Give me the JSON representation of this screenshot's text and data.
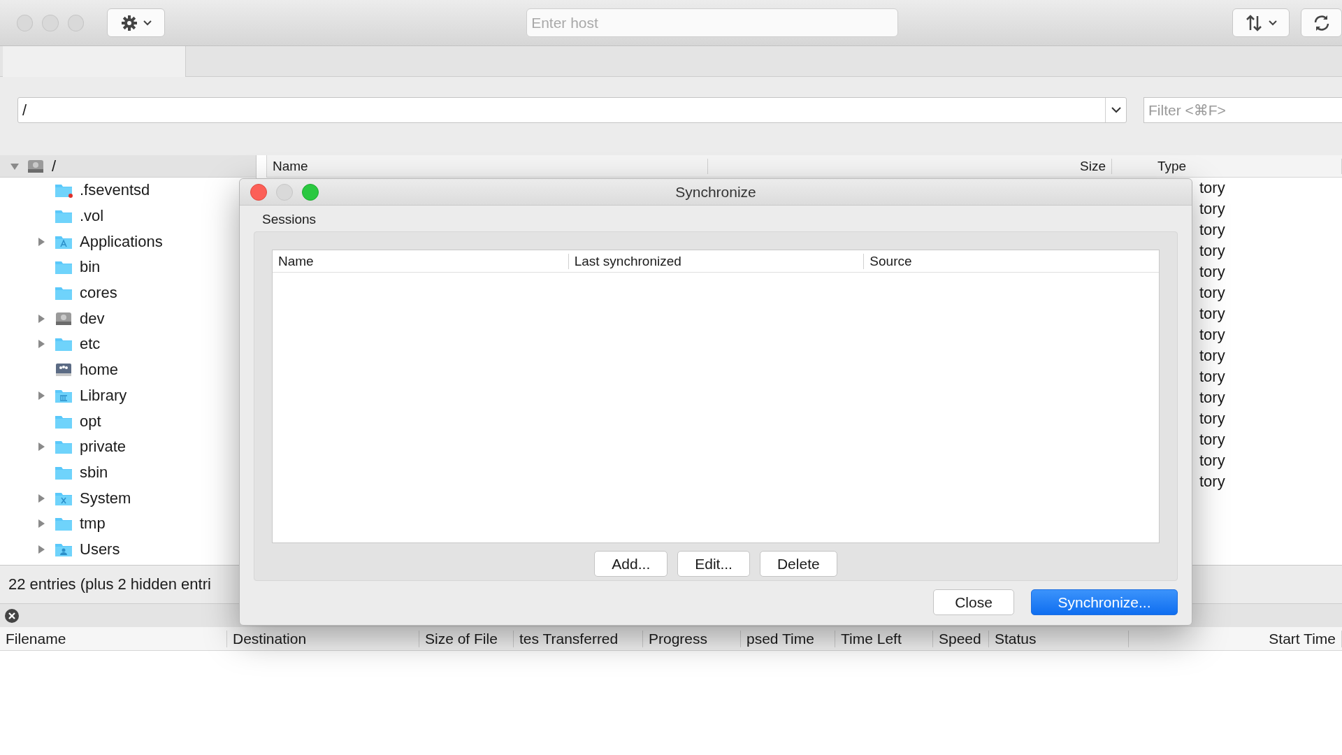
{
  "toolbar": {
    "host_field": {
      "placeholder": "Enter host"
    }
  },
  "path_bar": {
    "path": "/",
    "filter": {
      "placeholder": "Filter <⌘F>"
    }
  },
  "local_tree": {
    "root": {
      "label": "/",
      "expanded": true,
      "children": [
        {
          "label": ".fseventsd",
          "kind": "restricted-folder",
          "expandable": false
        },
        {
          "label": ".vol",
          "kind": "folder",
          "expandable": false
        },
        {
          "label": "Applications",
          "kind": "applications-folder",
          "expandable": true
        },
        {
          "label": "bin",
          "kind": "folder",
          "expandable": false
        },
        {
          "label": "cores",
          "kind": "folder",
          "expandable": false
        },
        {
          "label": "dev",
          "kind": "disk",
          "expandable": true
        },
        {
          "label": "etc",
          "kind": "folder",
          "expandable": true
        },
        {
          "label": "home",
          "kind": "server",
          "expandable": false
        },
        {
          "label": "Library",
          "kind": "library-folder",
          "expandable": true
        },
        {
          "label": "opt",
          "kind": "folder",
          "expandable": false
        },
        {
          "label": "private",
          "kind": "folder",
          "expandable": true
        },
        {
          "label": "sbin",
          "kind": "folder",
          "expandable": false
        },
        {
          "label": "System",
          "kind": "system-folder",
          "expandable": true
        },
        {
          "label": "tmp",
          "kind": "folder",
          "expandable": true
        },
        {
          "label": "Users",
          "kind": "users-folder",
          "expandable": true
        }
      ]
    }
  },
  "file_list": {
    "columns": [
      "Name",
      "Size",
      "Type"
    ],
    "rows": [
      {
        "type": "tory"
      },
      {
        "type": "tory"
      },
      {
        "type": "tory"
      },
      {
        "type": "tory"
      },
      {
        "type": "tory"
      },
      {
        "type": "tory"
      },
      {
        "type": "tory"
      },
      {
        "type": "tory"
      },
      {
        "type": "tory"
      },
      {
        "type": "tory"
      },
      {
        "type": "tory"
      },
      {
        "type": "tory"
      },
      {
        "type": "tory"
      },
      {
        "type": "tory"
      },
      {
        "type": "tory"
      }
    ]
  },
  "status_bar": "22 entries (plus 2 hidden entri",
  "queue": {
    "columns": [
      "Filename",
      "Destination",
      "Size of File",
      "tes Transferred",
      "Progress",
      "psed Time",
      "Time Left",
      "Speed",
      "Status",
      "Start Time"
    ]
  },
  "dialog": {
    "title": "Synchronize",
    "section": "Sessions",
    "columns": [
      "Name",
      "Last synchronized",
      "Source"
    ],
    "session_buttons": [
      "Add...",
      "Edit...",
      "Delete"
    ],
    "buttons": [
      {
        "label": "Close",
        "primary": false
      },
      {
        "label": "Synchronize...",
        "primary": true
      }
    ]
  }
}
